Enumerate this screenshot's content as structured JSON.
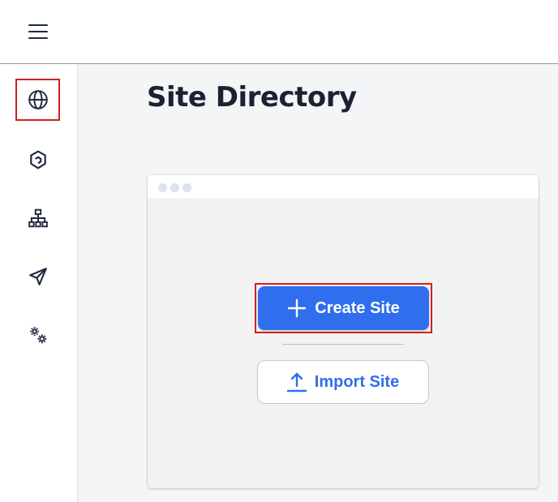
{
  "header": {
    "menu_icon": "hamburger-menu-icon"
  },
  "sidebar": {
    "items": [
      {
        "name": "sites",
        "icon": "globe-icon",
        "active": true
      },
      {
        "name": "integrations",
        "icon": "hexagon-link-icon",
        "active": false
      },
      {
        "name": "sitemap",
        "icon": "sitemap-icon",
        "active": false
      },
      {
        "name": "publish",
        "icon": "paper-plane-icon",
        "active": false
      },
      {
        "name": "settings",
        "icon": "gears-icon",
        "active": false
      }
    ]
  },
  "main": {
    "title": "Site Directory",
    "card": {
      "create_button_label": "Create Site",
      "import_button_label": "Import Site"
    }
  },
  "colors": {
    "accent": "#2f6fed",
    "highlight": "#d0201f",
    "title": "#1a2233",
    "background": "#f4f5f7"
  }
}
